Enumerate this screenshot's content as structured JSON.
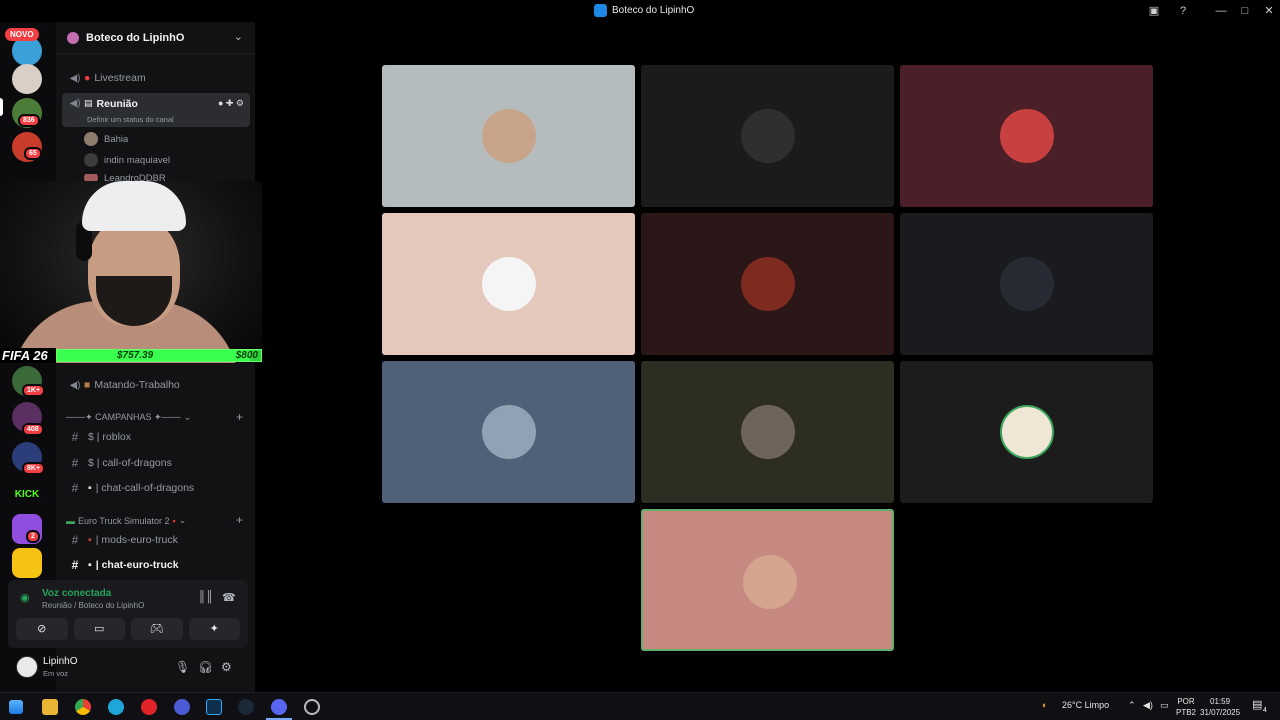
{
  "window": {
    "title": "Boteco do LipinhO",
    "controls": [
      "minimize-icon",
      "maximize-icon",
      "close-icon"
    ]
  },
  "rail": {
    "novo_label": "NOVO",
    "badges": [
      "836",
      "65",
      "1K+",
      "408",
      "8K+",
      "2"
    ],
    "kick_label": "KICK"
  },
  "server": {
    "name": "Boteco do LipinhO",
    "channels_top": [
      {
        "name": "Livestream",
        "type": "voice"
      },
      {
        "name": "Reunião",
        "type": "voice",
        "status": "Definir um status do canal"
      }
    ],
    "members": [
      "Bahia",
      "indin maquiavel",
      "LeandroDDBR"
    ],
    "channel_matando": "Matando-Trabalho",
    "category_campanhas": "───✦ CAMPANHAS ✦───",
    "campanhas_channels": [
      "$ | roblox",
      "$ | call-of-dragons",
      "| chat-call-of-dragons"
    ],
    "category_euro": "Euro Truck Simulator 2",
    "euro_channels": [
      "| mods-euro-truck",
      "| chat-euro-truck"
    ]
  },
  "overlay": {
    "game": "FIFA 26",
    "current": "$757.39",
    "goal": "$800",
    "progress": 0.9467
  },
  "voice": {
    "status": "Voz conectada",
    "location": "Reunião / Boteco do LipinhO"
  },
  "user": {
    "name": "LipinhO",
    "status": "Em voz"
  },
  "tiles": [
    {
      "bg": "#b5bcbd",
      "speaking": false
    },
    {
      "bg": "#1b1b1b",
      "speaking": false
    },
    {
      "bg": "#4a1f28",
      "speaking": false
    },
    {
      "bg": "#e4c8bb",
      "speaking": false
    },
    {
      "bg": "#2a1616",
      "speaking": false
    },
    {
      "bg": "#1a1b1e",
      "speaking": false
    },
    {
      "bg": "#4f6079",
      "speaking": false
    },
    {
      "bg": "#2d2d22",
      "speaking": false
    },
    {
      "bg": "#1c1c1d",
      "speaking": false
    },
    {
      "bg": "#c58982",
      "speaking": true
    }
  ],
  "taskbar": {
    "weather": "26°C  Limpo",
    "lang1": "POR",
    "lang2": "PTB2",
    "time": "01:59",
    "date": "31/07/2025",
    "notif_count": "4"
  }
}
